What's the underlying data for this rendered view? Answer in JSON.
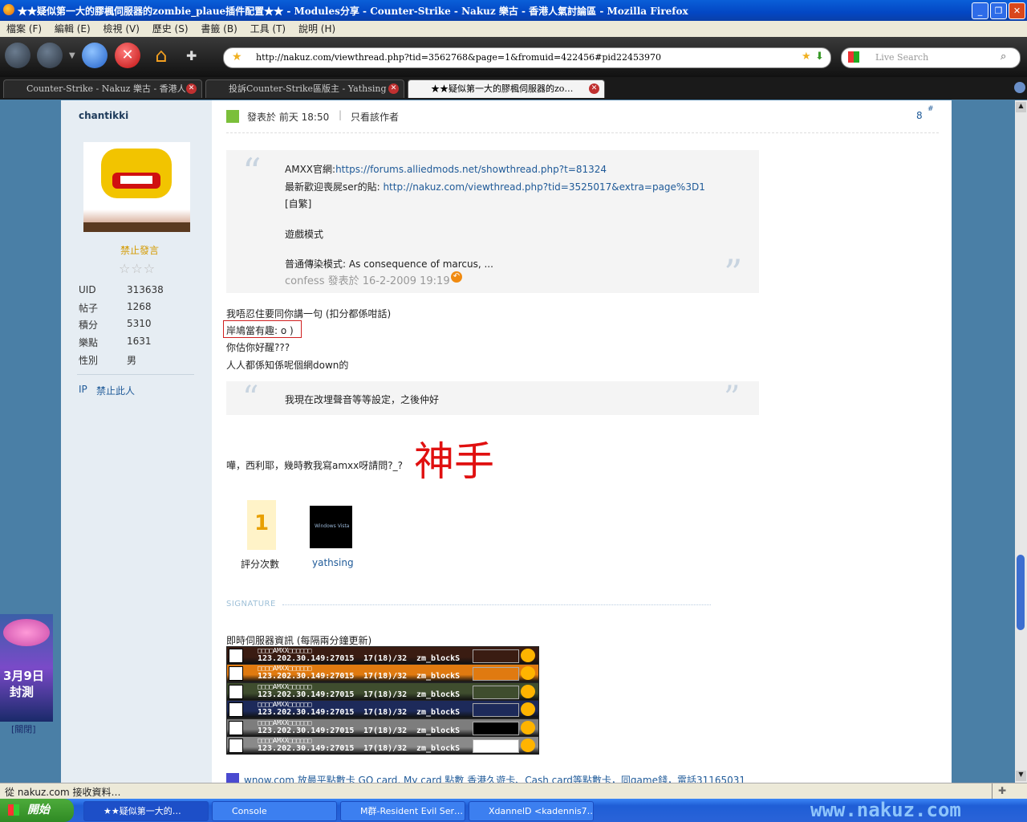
{
  "window": {
    "title": "★★疑似第一大的膠楓伺服器的zombie_plaue插件配置★★ - Modules分享 - Counter-Strike - Nakuz 樂古 - 香港人氣討論區 - Mozilla Firefox"
  },
  "menu": [
    "檔案 (F)",
    "編輯 (E)",
    "檢視 (V)",
    "歷史 (S)",
    "書籤 (B)",
    "工具 (T)",
    "說明 (H)"
  ],
  "address": {
    "url": "http://nakuz.com/viewthread.php?tid=3562768&page=1&fromuid=422456#pid22453970"
  },
  "search": {
    "placeholder": "Live Search"
  },
  "tabs": [
    {
      "label": "Counter-Strike - Nakuz 樂古 - 香港人…"
    },
    {
      "label": "投訴Counter-Strike區版主 - Yathsing …"
    },
    {
      "label": "★★疑似第一大的膠楓伺服器的zo…"
    }
  ],
  "user": {
    "name": "chantikki",
    "status": "禁止發言",
    "stats": [
      {
        "label": "UID",
        "value": "313638"
      },
      {
        "label": "帖子",
        "value": "1268"
      },
      {
        "label": "積分",
        "value": "5310"
      },
      {
        "label": "樂點",
        "value": "1631"
      },
      {
        "label": "性別",
        "value": "男"
      }
    ],
    "ip_link": "IP",
    "ban_link": "禁止此人"
  },
  "post": {
    "meta": "發表於 前天 18:50",
    "only_author": "只看該作者",
    "floor": "8",
    "floor_mark": "#",
    "quote1": {
      "l1_prefix": "AMXX官網:",
      "l1_link": "https://forums.alliedmods.net/showthread.php?t=81324",
      "l2_prefix": "最新歡迎喪屍ser的貼: ",
      "l2_link": "http://nakuz.com/viewthread.php?tid=3525017&extra=page%3D1",
      "l3": "[自繁]",
      "l4": "遊戲模式",
      "l5": "普通傳染模式: As consequence of marcus,  ...",
      "by": "confess 發表於 16-2-2009 19:19"
    },
    "line1": "我唔忍住要同你講一句 (扣分都係咁話)",
    "line2": "岸鳩當有趣: o )",
    "line3": "你估你好醒???",
    "line4": "人人都係知係呢個網down的",
    "quote2": "我現在改埋聲音等等設定，之後仲好",
    "line5": "嘩，西利耶，幾時教我寫amxx呀請問?_?",
    "big": "神手",
    "rate_count": "1",
    "rate_label": "評分次數",
    "rater": "yathsing",
    "rater_logo": "Windows Vista",
    "signature_label": "SIGNATURE",
    "sig_title": "即時伺服器資訊 (每隔兩分鐘更新)",
    "servers": [
      {
        "name": "□□□□AMXX□□□□□□",
        "addr": "123.202.30.149:27015",
        "players": "17(18)/32",
        "map": "zm_blockS",
        "color": "#3a1c12"
      },
      {
        "name": "□□□□AMXX□□□□□□",
        "addr": "123.202.30.149:27015",
        "players": "17(18)/32",
        "map": "zm_blockS",
        "color": "#e07a10"
      },
      {
        "name": "□□□□AMXX□□□□□□",
        "addr": "123.202.30.149:27015",
        "players": "17(18)/32",
        "map": "zm_blockS",
        "color": "#3f4d2e"
      },
      {
        "name": "□□□□AMXX□□□□□□",
        "addr": "123.202.30.149:27015",
        "players": "17(18)/32",
        "map": "zm_blockS",
        "color": "#1d2a5a"
      },
      {
        "name": "□□□□AMXX□□□□□□",
        "addr": "123.202.30.149:27015",
        "players": "17(18)/32",
        "map": "zm_blockS",
        "color": "#7d7d7d"
      },
      {
        "name": "□□□□AMXX□□□□□□",
        "addr": "123.202.30.149:27015",
        "players": "17(18)/32",
        "map": "zm_blockS",
        "color": "#8a8a8a"
      }
    ],
    "ad": "wnow.com 放最平點數卡 GO card, My card 點數 香港久遊卡、Cash card等點數卡，同game錢，電話31165031"
  },
  "side_ad": {
    "date": "3月9日",
    "event": "封測",
    "close": "[關閉]"
  },
  "statusbar": {
    "text": "從 nakuz.com 接收資料…"
  },
  "taskbar": {
    "start": "開始",
    "items": [
      "★★疑似第一大的…",
      "Console",
      "M群-Resident Evil Ser…",
      "XdannelD <kadennis7…"
    ],
    "watermark": "www.nakuz.com"
  }
}
